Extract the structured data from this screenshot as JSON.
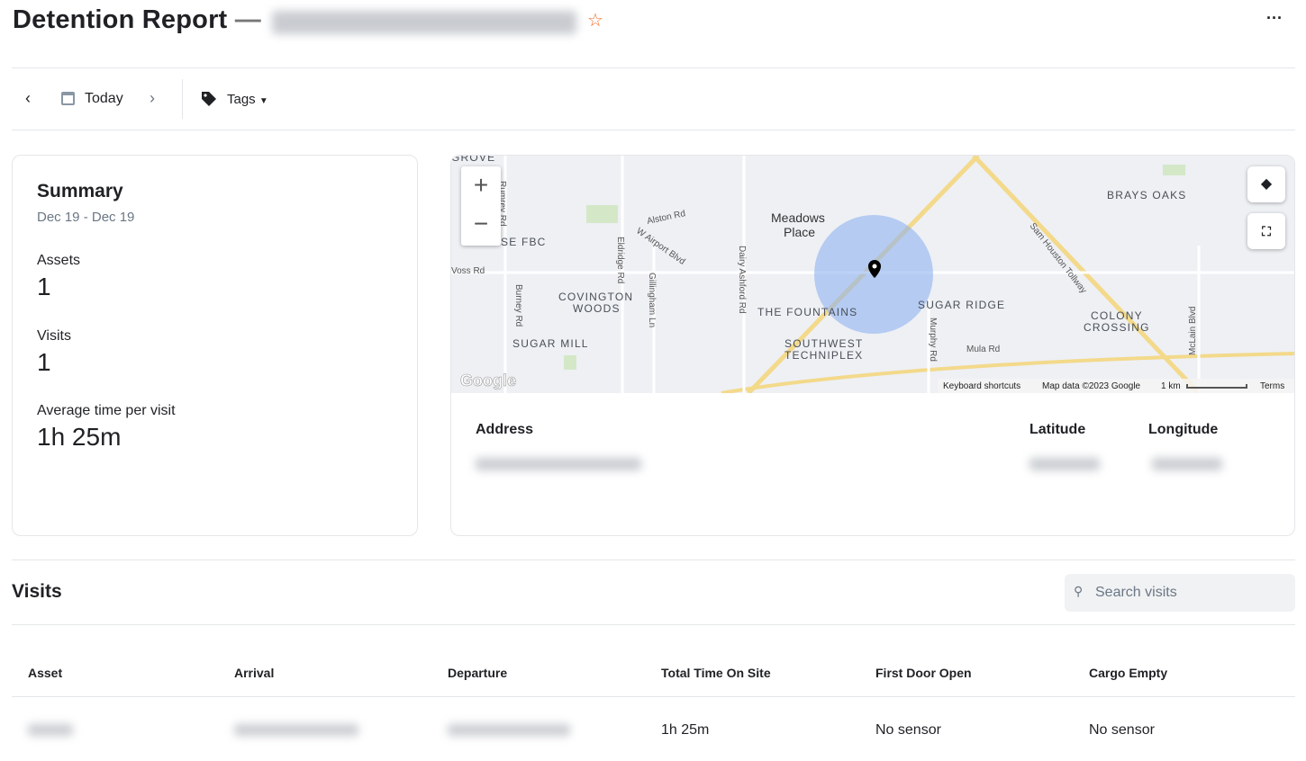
{
  "header": {
    "title": "Detention Report",
    "separator": "—",
    "more": "···"
  },
  "toolbar": {
    "date_label": "Today",
    "tags_label": "Tags"
  },
  "summary": {
    "title": "Summary",
    "date_range": "Dec 19 - Dec 19",
    "assets_label": "Assets",
    "assets_value": "1",
    "visits_label": "Visits",
    "visits_value": "1",
    "avg_label": "Average time per visit",
    "avg_value": "1h 25m"
  },
  "map": {
    "labels": [
      "GROVE",
      "Meadows",
      "Place",
      "BRAYS OAKS",
      "SE FBC",
      "COVINGTON",
      "WOODS",
      "SUGAR MILL",
      "THE FOUNTAINS",
      "SUGAR RIDGE",
      "COLONY",
      "CROSSING",
      "SOUTHWEST",
      "TECHNIPLEX"
    ],
    "roads": [
      "Alston Rd",
      "W Airport Blvd",
      "Voss Rd",
      "Eldridge Rd",
      "Gillingham Ln",
      "Dairy Ashford Rd",
      "Murphy Rd",
      "Mula Rd",
      "Sam Houston Tollway",
      "McLain Blvd",
      "Burney Rd",
      "Rumrey Rd"
    ],
    "footer": {
      "keyboard": "Keyboard shortcuts",
      "data": "Map data ©2023 Google",
      "scale": "1 km",
      "terms": "Terms",
      "logo": "Google"
    },
    "zoom_in": "+",
    "zoom_out": "−",
    "marker_color": "#000000",
    "radius_color": "#8fb2f0"
  },
  "location": {
    "address_label": "Address",
    "latitude_label": "Latitude",
    "longitude_label": "Longitude"
  },
  "visits": {
    "title": "Visits",
    "search_placeholder": "Search visits",
    "columns": [
      "Asset",
      "Arrival",
      "Departure",
      "Total Time On Site",
      "First Door Open",
      "Cargo Empty"
    ],
    "rows": [
      {
        "total_time": "1h 25m",
        "first_door_open": "No sensor",
        "cargo_empty": "No sensor"
      }
    ]
  },
  "colors": {
    "star": "#f06a25",
    "accent": "#1f2124"
  }
}
